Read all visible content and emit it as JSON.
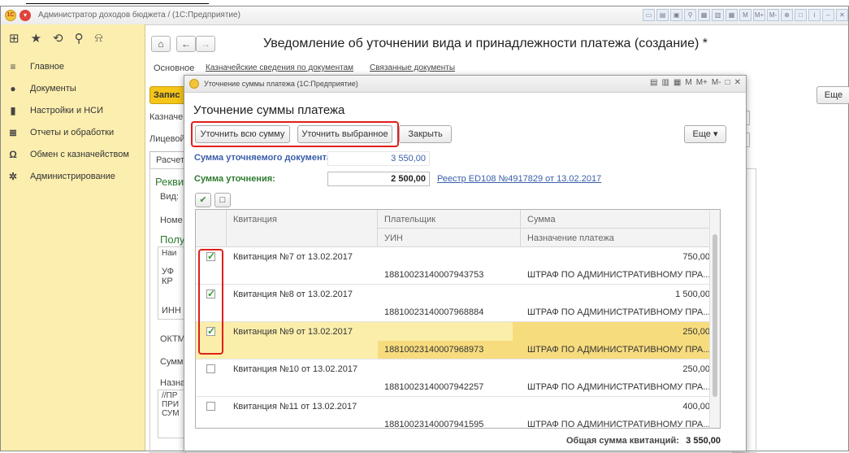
{
  "app": {
    "title": "Администратор доходов бюджета /  (1С:Предприятие)",
    "logo_text": "1С",
    "toolbar_icons": [
      "save-icon",
      "print-icon",
      "preview-icon",
      "link-icon",
      "help-icon",
      "table-icon",
      "calendar-icon",
      "memory-m-icon",
      "memory-plus-icon",
      "memory-minus-icon",
      "zoom-icon",
      "window-icon",
      "info-icon",
      "minimize-icon",
      "close-icon"
    ],
    "toolbar_m": "M",
    "toolbar_mplus": "M+",
    "toolbar_mminus": "M-"
  },
  "sidebar": {
    "items": [
      {
        "label": "Главное",
        "icon": "menu-icon"
      },
      {
        "label": "Документы",
        "icon": "documents-icon"
      },
      {
        "label": "Настройки и НСИ",
        "icon": "settings-icon"
      },
      {
        "label": "Отчеты и обработки",
        "icon": "reports-icon"
      },
      {
        "label": "Обмен с казначейством",
        "icon": "treasury-exchange-icon"
      },
      {
        "label": "Администрирование",
        "icon": "admin-icon"
      }
    ]
  },
  "form": {
    "title": "Уведомление об уточнении вида и принадлежности платежа (создание) *",
    "tabs": [
      "Основное",
      "Казначейские сведения по документам",
      "Связанные документы"
    ],
    "more_label": "Еще",
    "bg_labels": [
      "Запис",
      "Казначе",
      "Лицевой",
      "Расчет",
      "Рекви",
      "Вид:",
      "Номе",
      "Полу",
      "Наи",
      "УФ",
      "КР",
      "ИНН",
      "ОКТМ",
      "Сумм",
      "Назна",
      "//ПР",
      "ПРИ",
      "СУМ"
    ]
  },
  "dialog": {
    "title": "Уточнение суммы платежа  (1С:Предприятие)",
    "header": "Уточнение суммы платежа",
    "buttons": {
      "refine_all": "Уточнить всю сумму",
      "refine_selected": "Уточнить выбранное",
      "close": "Закрыть",
      "more": "Еще"
    },
    "doc_sum_label": "Сумма уточняемого документа:",
    "doc_sum_value": "3 550,00",
    "refine_sum_label": "Сумма уточнения:",
    "refine_sum_value": "2 500,00",
    "registry_link": "Реестр ED108 №4917829 от 13.02.2017",
    "grid": {
      "columns": {
        "receipt": "Квитанция",
        "payer": "Плательщик",
        "uin": "УИН",
        "sum": "Сумма",
        "purpose": "Назначение платежа"
      },
      "rows": [
        {
          "checked": true,
          "name": "Квитанция №7 от 13.02.2017",
          "uin": "18810023140007943753",
          "sum": "750,00",
          "purpose": "ШТРАФ ПО АДМИНИСТРАТИВНОМУ ПРА..."
        },
        {
          "checked": true,
          "name": "Квитанция №8 от 13.02.2017",
          "uin": "18810023140007968884",
          "sum": "1 500,00",
          "purpose": "ШТРАФ ПО АДМИНИСТРАТИВНОМУ ПРА..."
        },
        {
          "checked": true,
          "name": "Квитанция №9 от 13.02.2017",
          "uin": "18810023140007968973",
          "sum": "250,00",
          "purpose": "ШТРАФ ПО АДМИНИСТРАТИВНОМУ ПРА..."
        },
        {
          "checked": false,
          "name": "Квитанция №10 от 13.02.2017",
          "uin": "18810023140007942257",
          "sum": "250,00",
          "purpose": "ШТРАФ ПО АДМИНИСТРАТИВНОМУ ПРА..."
        },
        {
          "checked": false,
          "name": "Квитанция №11 от 13.02.2017",
          "uin": "18810023140007941595",
          "sum": "400,00",
          "purpose": "ШТРАФ ПО АДМИНИСТРАТИВНОМУ ПРА..."
        }
      ]
    },
    "total_label": "Общая сумма квитанций:",
    "total_value": "3 550,00",
    "title_icons": [
      "save-icon",
      "table-icon",
      "calendar-icon",
      "memory-m-icon",
      "memory-plus-icon",
      "memory-minus-icon",
      "maximize-icon",
      "close-icon"
    ],
    "title_m": "M",
    "title_mplus": "M+",
    "title_mminus": "M-"
  },
  "colors": {
    "sidebar": "#fbeeae",
    "selected_row": "#fbeeab",
    "highlight_red": "#e0201a",
    "link": "#3b5fa9",
    "green_label": "#2f7a2f"
  }
}
